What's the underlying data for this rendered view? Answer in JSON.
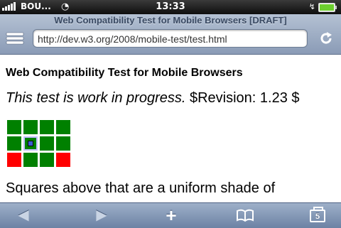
{
  "status_bar": {
    "carrier": "BOU...",
    "time": "13:33"
  },
  "browser": {
    "page_title": "Web Compatibility Test for Mobile Browsers [DRAFT]",
    "url": "http://dev.w3.org/2008/mobile-test/test.html",
    "tab_count": "5"
  },
  "page": {
    "heading": "Web Compatibility Test for Mobile Browsers",
    "progress_italic": "This test is work in progress.",
    "revision": " $Revision: 1.23 $",
    "paragraph": "Squares above that are a uniform shade of"
  },
  "test_grid": {
    "colors": {
      "pass": "#008000",
      "fail": "#ff0000",
      "center_fill": "#3a5bd0"
    },
    "cells": [
      "pass",
      "pass",
      "pass",
      "pass",
      "pass",
      "center",
      "pass",
      "pass",
      "fail",
      "pass",
      "pass",
      "fail"
    ]
  },
  "icons": {
    "signal": "signal-bars-icon",
    "wifi": "wifi-icon",
    "battery": "battery-icon",
    "bookmarks": "bookmarks-icon",
    "reload": "reload-icon",
    "back": "back-arrow-icon",
    "forward": "forward-arrow-icon",
    "add": "plus-icon",
    "book": "open-book-icon",
    "pages": "pages-icon"
  }
}
